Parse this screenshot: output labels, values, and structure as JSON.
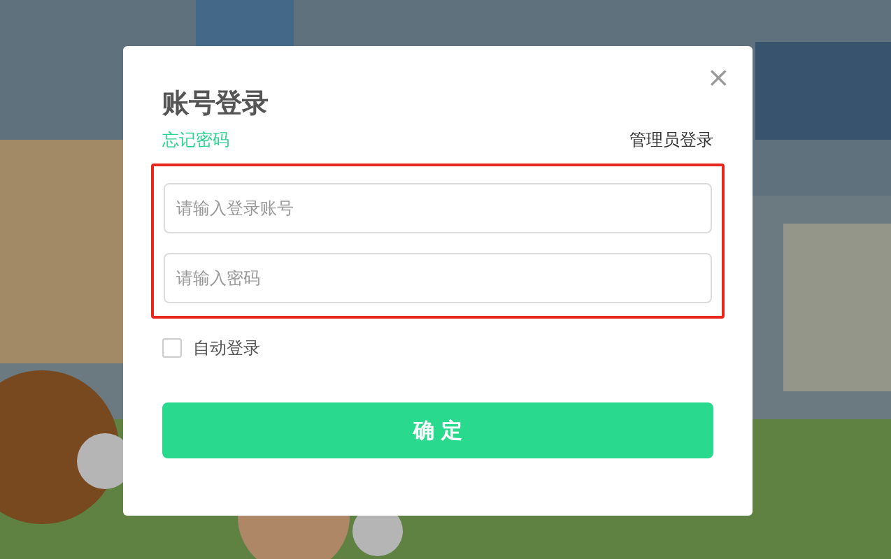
{
  "dialog": {
    "title": "账号登录",
    "close": "×",
    "forgot_link": "忘记密码",
    "admin_link": "管理员登录",
    "fields": [
      {
        "placeholder": "请输入登录账号"
      },
      {
        "placeholder": "请输入密码"
      }
    ],
    "highlighted": true,
    "auto_login": {
      "label": "自动登录",
      "checked": false
    },
    "submit": "确 定"
  }
}
